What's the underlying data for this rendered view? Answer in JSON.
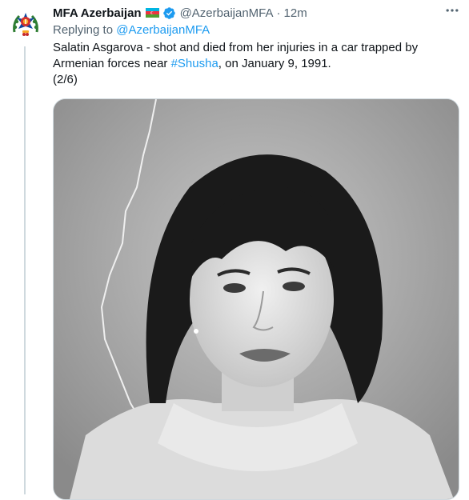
{
  "tweet": {
    "display_name": "MFA Azerbaijan",
    "flag_icon": "azerbaijan-flag-icon",
    "verified_icon": "verified-badge-icon",
    "handle": "@AzerbaijanMFA",
    "separator": "·",
    "time": "12m",
    "replying_prefix": "Replying to ",
    "replying_handle": "@AzerbaijanMFA",
    "text_part1": "Salatin Asgarova - shot and died from her injuries in a car trapped by Armenian forces near ",
    "hashtag": "#Shusha",
    "text_part2": ", on January 9, 1991.",
    "thread_count": "(2/6)",
    "media_description_icon": "black-and-white-portrait-photo"
  },
  "colors": {
    "accent": "#1d9bf0",
    "secondary_text": "#536471",
    "primary_text": "#0f1419",
    "border": "#cfd9de",
    "flag_blue": "#00b5e2",
    "flag_red": "#ef3340",
    "flag_green": "#509e2f"
  }
}
